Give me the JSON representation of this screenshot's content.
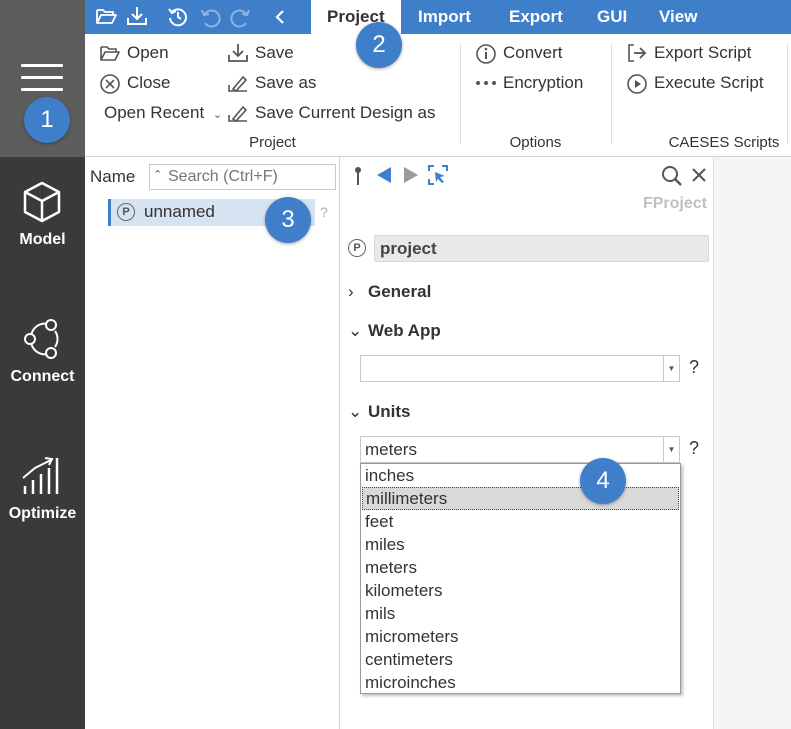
{
  "badges": [
    "1",
    "2",
    "3",
    "4"
  ],
  "sidebar": {
    "items": [
      {
        "label": "Model",
        "icon": "cube-icon"
      },
      {
        "label": "Connect",
        "icon": "connect-icon"
      },
      {
        "label": "Optimize",
        "icon": "chart-bars-icon"
      }
    ]
  },
  "quick_access": [
    "folder-open-icon",
    "download-icon",
    "history-icon",
    "undo-icon",
    "redo-icon",
    "collapse-left-icon"
  ],
  "menu_tabs": [
    "Project",
    "Import",
    "Export",
    "GUI",
    "View"
  ],
  "ribbon": {
    "project": {
      "open": "Open",
      "close": "Close",
      "open_recent": "Open Recent",
      "save": "Save",
      "save_as": "Save as",
      "save_current_design": "Save Current Design as",
      "group_label": "Project"
    },
    "options": {
      "convert": "Convert",
      "encryption": "Encryption",
      "group_label": "Options"
    },
    "scripts": {
      "export_script": "Export Script",
      "execute_script": "Execute Script",
      "group_label": "CAESES Scripts"
    }
  },
  "tree": {
    "name_label": "Name",
    "search_placeholder": "Search (Ctrl+F)",
    "item": {
      "badge": "P",
      "label": "unnamed"
    },
    "help": "?"
  },
  "properties": {
    "type_label": "FProject",
    "object_badge": "P",
    "object_name": "project",
    "sections": {
      "general": "General",
      "web_app": "Web App",
      "units": "Units"
    },
    "web_app_value": "",
    "units_value": "meters",
    "help": "?"
  },
  "units_dropdown": {
    "options": [
      "inches",
      "millimeters",
      "feet",
      "miles",
      "meters",
      "kilometers",
      "mils",
      "micrometers",
      "centimeters",
      "microinches"
    ],
    "highlighted": "millimeters"
  },
  "colors": {
    "accent": "#3f7fca",
    "sidebar": "#3a3a3a",
    "sidebar_top": "#5d5d5d",
    "tree_selection": "#d6e3f1"
  }
}
